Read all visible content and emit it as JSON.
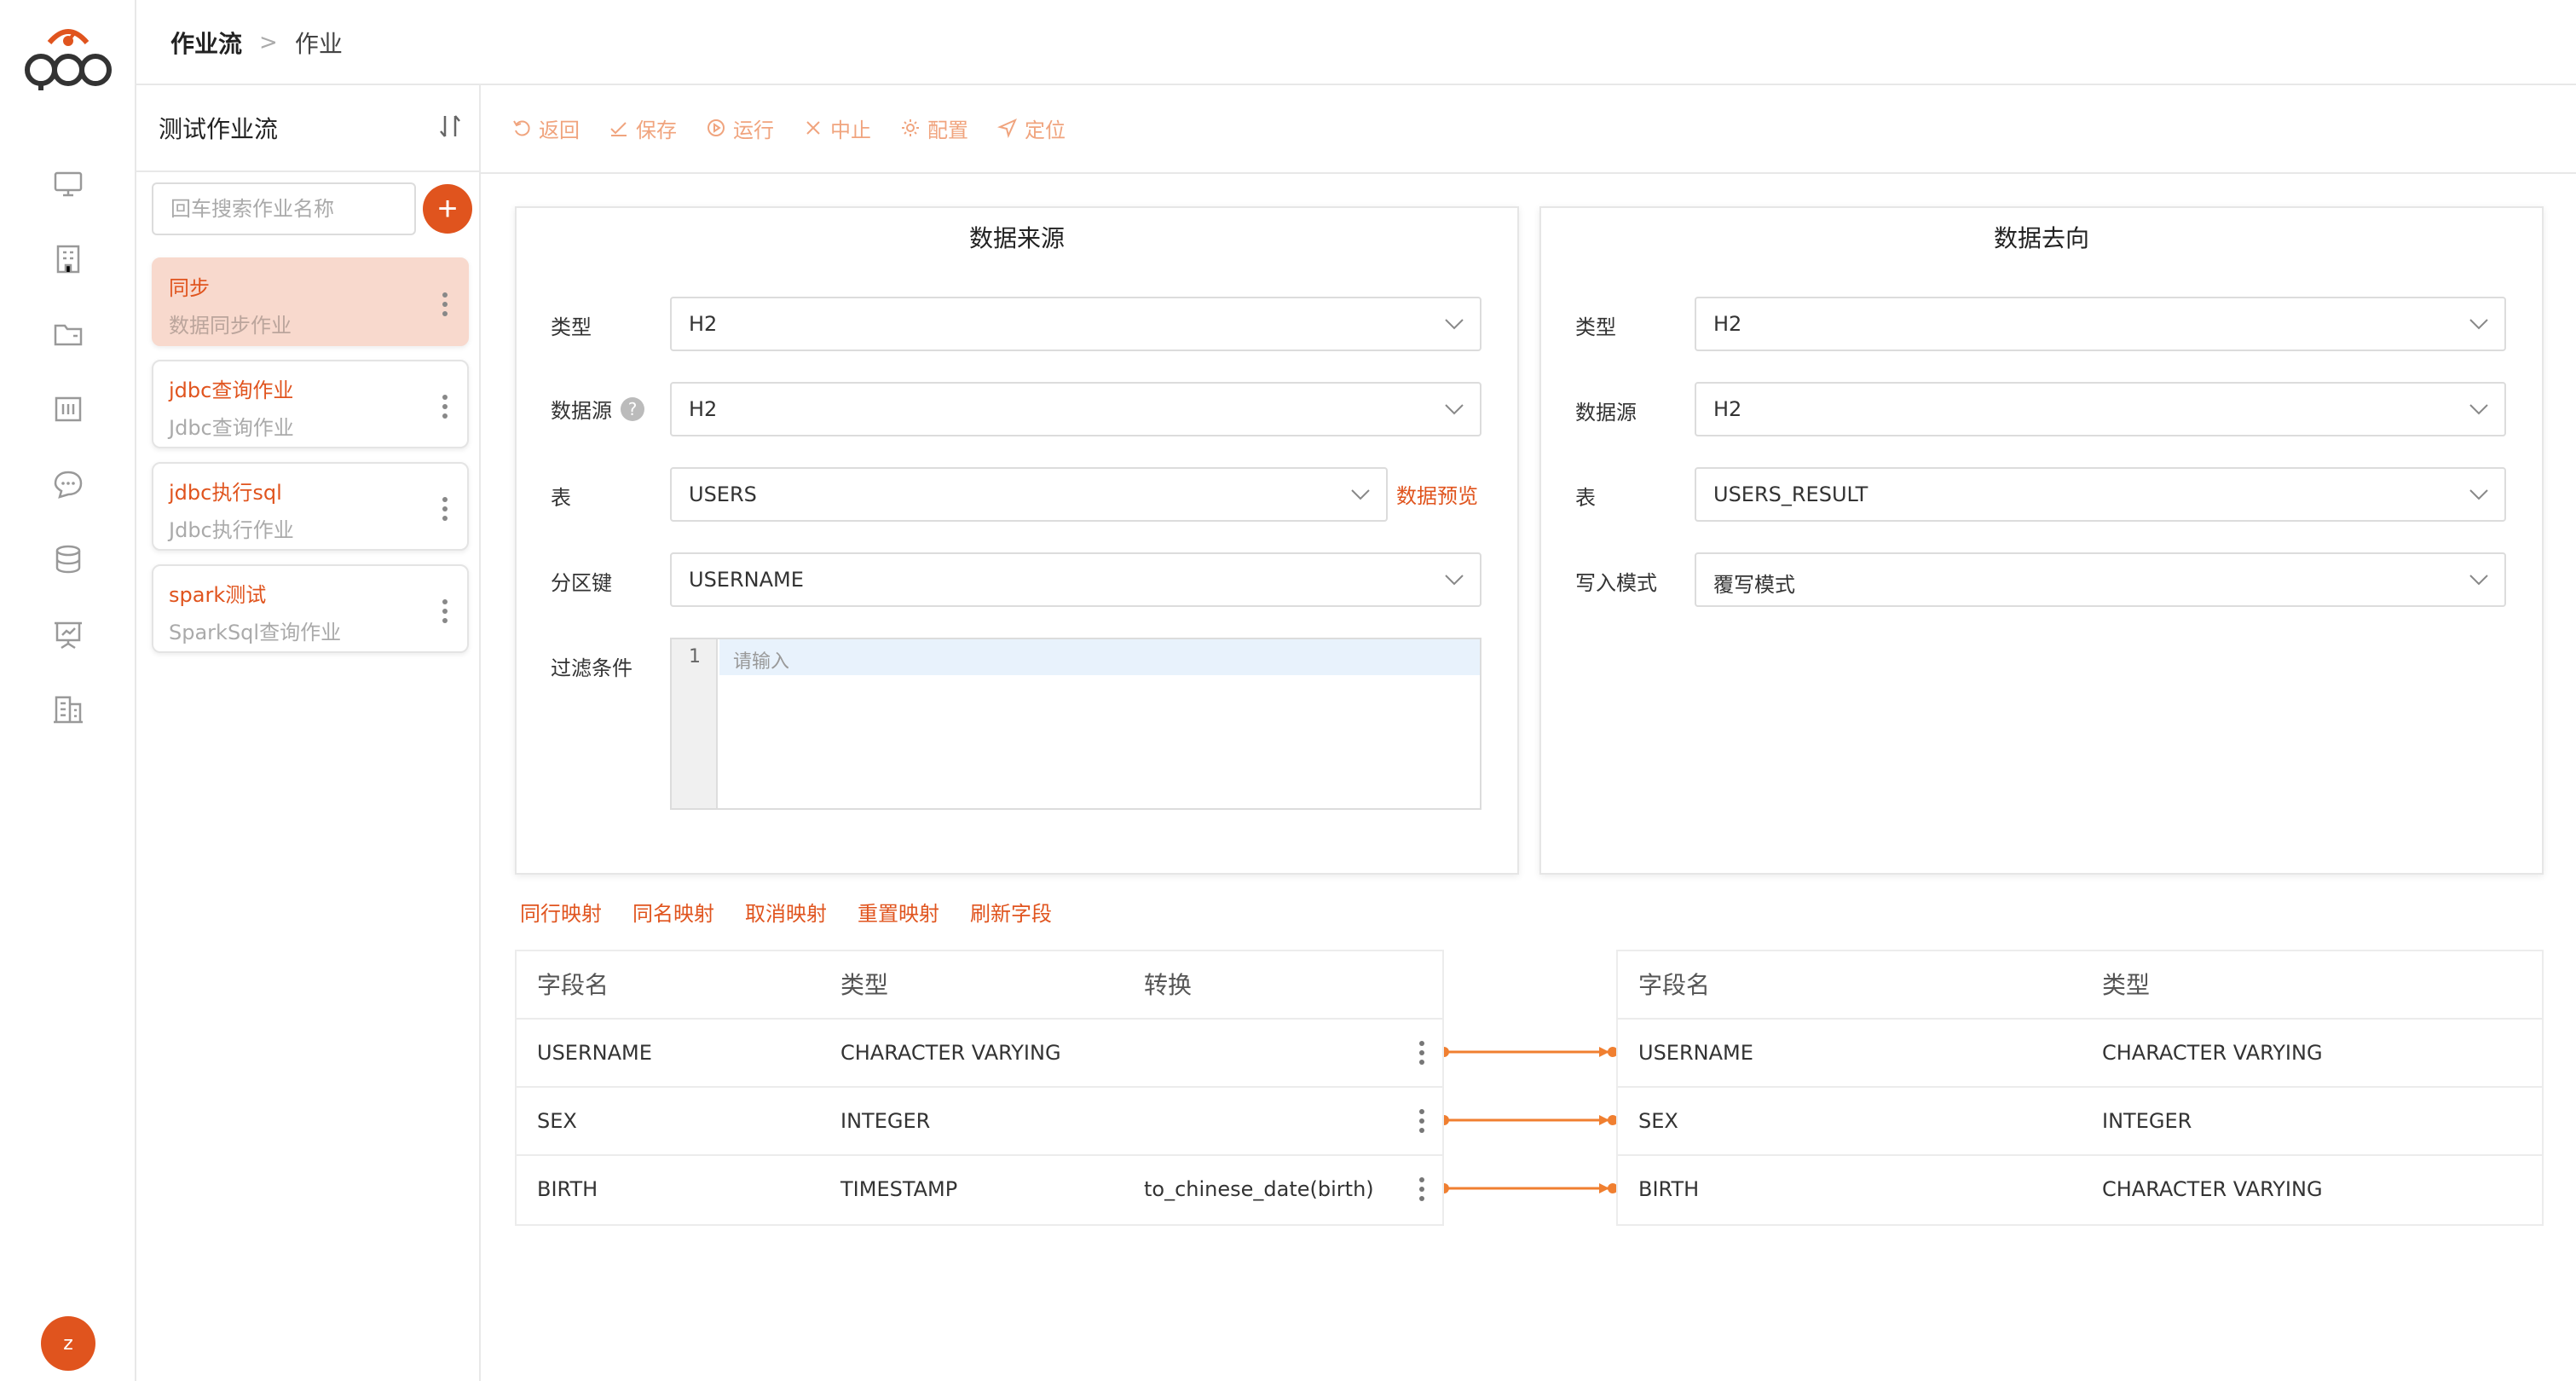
{
  "header": {
    "breadcrumb_parent": "作业流",
    "breadcrumb_separator": ">",
    "breadcrumb_current": "作业"
  },
  "user": {
    "avatar_initial": "z"
  },
  "colors": {
    "accent": "#e0541e",
    "accent_light": "#f0a47e",
    "active_card": "#f8d9cd",
    "link_line": "#f07f30"
  },
  "rail_icons": [
    "monitor-icon",
    "building-icon",
    "folder-icon",
    "board-icon",
    "chat-icon",
    "database-icon",
    "presentation-icon",
    "office-icon"
  ],
  "job_panel": {
    "flow_name": "测试作业流",
    "search_placeholder": "回车搜索作业名称",
    "add_label": "+",
    "jobs": [
      {
        "name": "同步",
        "desc": "数据同步作业",
        "active": true
      },
      {
        "name": "jdbc查询作业",
        "desc": "Jdbc查询作业",
        "active": false
      },
      {
        "name": "jdbc执行sql",
        "desc": "Jdbc执行作业",
        "active": false
      },
      {
        "name": "spark测试",
        "desc": "SparkSql查询作业",
        "active": false
      }
    ]
  },
  "toolbar": {
    "back": "返回",
    "save": "保存",
    "run": "运行",
    "stop": "中止",
    "config": "配置",
    "locate": "定位"
  },
  "source": {
    "title": "数据来源",
    "type_label": "类型",
    "type_value": "H2",
    "datasource_label": "数据源",
    "datasource_help": "?",
    "datasource_value": "H2",
    "table_label": "表",
    "table_value": "USERS",
    "preview_link": "数据预览",
    "partition_label": "分区键",
    "partition_value": "USERNAME",
    "filter_label": "过滤条件",
    "filter_line_no": "1",
    "filter_placeholder": "请输入"
  },
  "target": {
    "title": "数据去向",
    "type_label": "类型",
    "type_value": "H2",
    "datasource_label": "数据源",
    "datasource_value": "H2",
    "table_label": "表",
    "table_value": "USERS_RESULT",
    "write_mode_label": "写入模式",
    "write_mode_value": "覆写模式"
  },
  "mapping_actions": {
    "row_map": "同行映射",
    "name_map": "同名映射",
    "cancel_map": "取消映射",
    "reset_map": "重置映射",
    "refresh_fields": "刷新字段"
  },
  "source_table": {
    "headers": {
      "field": "字段名",
      "type": "类型",
      "transform": "转换"
    },
    "rows": [
      {
        "field": "USERNAME",
        "type": "CHARACTER VARYING",
        "transform": ""
      },
      {
        "field": "SEX",
        "type": "INTEGER",
        "transform": ""
      },
      {
        "field": "BIRTH",
        "type": "TIMESTAMP",
        "transform": "to_chinese_date(birth)"
      }
    ]
  },
  "target_table": {
    "headers": {
      "field": "字段名",
      "type": "类型"
    },
    "rows": [
      {
        "field": "USERNAME",
        "type": "CHARACTER VARYING"
      },
      {
        "field": "SEX",
        "type": "INTEGER"
      },
      {
        "field": "BIRTH",
        "type": "CHARACTER VARYING"
      }
    ]
  }
}
